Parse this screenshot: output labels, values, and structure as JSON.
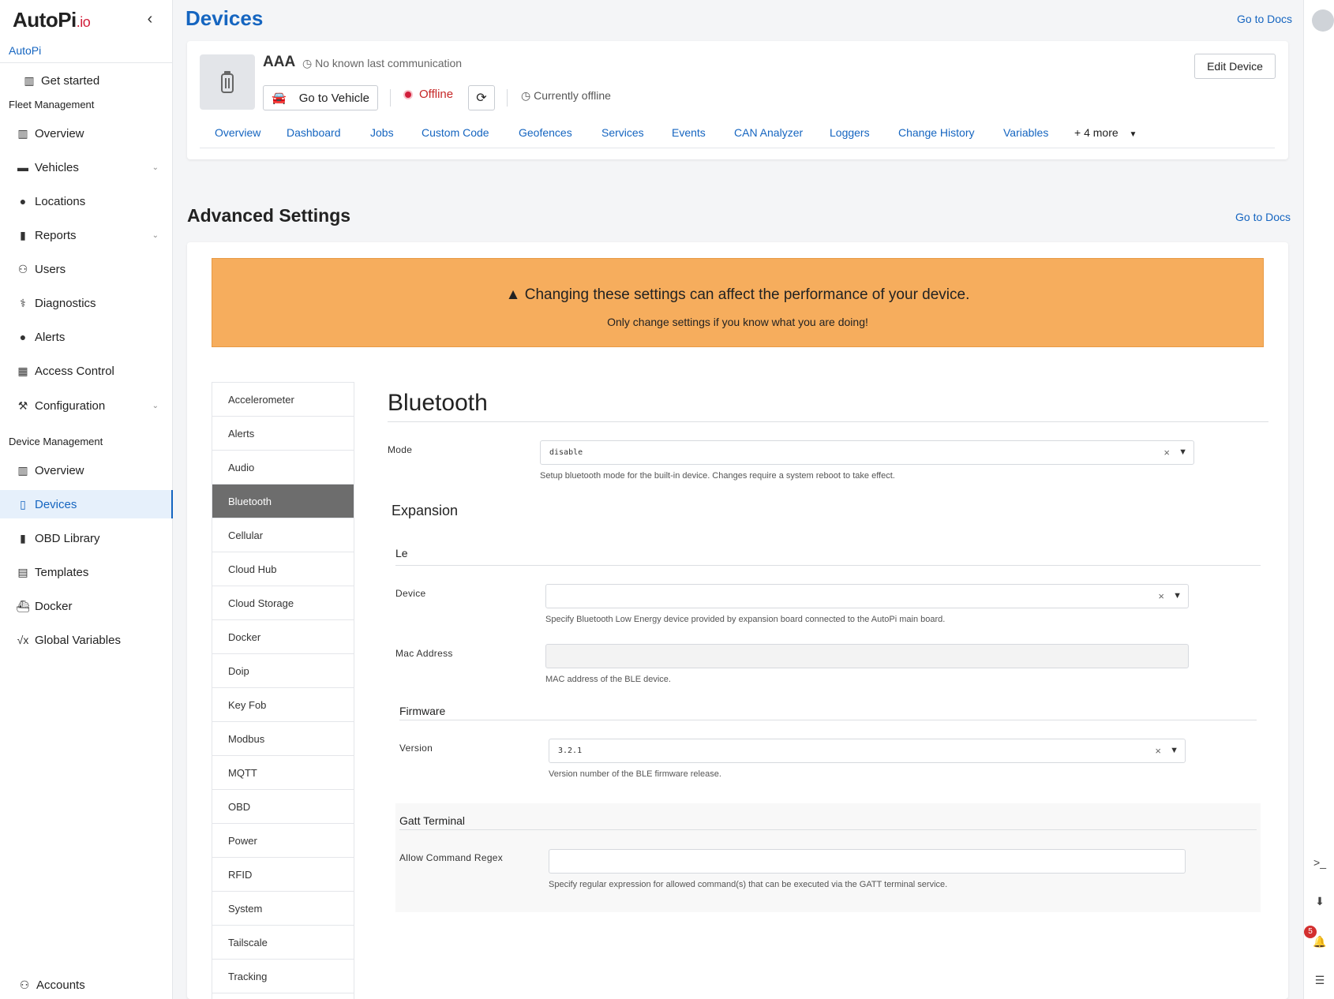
{
  "app": {
    "logo_main": "AutoPi",
    "logo_suffix": ".io",
    "org": "AutoPi"
  },
  "sidebar": {
    "get_started": "Get started",
    "fleet_label": "Fleet Management",
    "fleet_items": [
      {
        "label": "Overview",
        "icon": "chart-icon"
      },
      {
        "label": "Vehicles",
        "icon": "car-icon"
      },
      {
        "label": "Locations",
        "icon": "pin-icon"
      },
      {
        "label": "Reports",
        "icon": "file-icon"
      },
      {
        "label": "Users",
        "icon": "user-icon"
      },
      {
        "label": "Diagnostics",
        "icon": "stethoscope-icon"
      },
      {
        "label": "Alerts",
        "icon": "alert-icon"
      },
      {
        "label": "Access Control",
        "icon": "lock-icon"
      },
      {
        "label": "Configuration",
        "icon": "wrench-icon"
      }
    ],
    "device_label": "Device Management",
    "device_items": [
      {
        "label": "Overview",
        "icon": "chart-icon"
      },
      {
        "label": "Devices",
        "icon": "device-icon"
      },
      {
        "label": "OBD Library",
        "icon": "book-icon"
      },
      {
        "label": "Templates",
        "icon": "template-icon"
      },
      {
        "label": "Docker",
        "icon": "docker-icon"
      },
      {
        "label": "Global Variables",
        "icon": "variable-icon"
      }
    ],
    "accounts": "Accounts"
  },
  "header": {
    "title": "Devices",
    "docs": "Go to Docs"
  },
  "device": {
    "name": "AAA",
    "last_comm": "No known last communication",
    "go_to_vehicle": "Go to Vehicle",
    "status": "Offline",
    "current": "Currently offline",
    "edit": "Edit Device",
    "tabs": [
      "Overview",
      "Dashboard",
      "Jobs",
      "Custom Code",
      "Geofences",
      "Services",
      "Events",
      "CAN Analyzer",
      "Loggers",
      "Change History",
      "Variables",
      "+ 4 more"
    ]
  },
  "advanced": {
    "title": "Advanced Settings",
    "docs": "Go to Docs",
    "warning_title": "Changing these settings can affect the performance of your device.",
    "warning_sub": "Only change settings if you know what you are doing!",
    "menu": [
      "Accelerometer",
      "Alerts",
      "Audio",
      "Bluetooth",
      "Cellular",
      "Cloud Hub",
      "Cloud Storage",
      "Docker",
      "Doip",
      "Key Fob",
      "Modbus",
      "MQTT",
      "OBD",
      "Power",
      "RFID",
      "System",
      "Tailscale",
      "Tracking"
    ],
    "active_menu": "Bluetooth"
  },
  "bluetooth": {
    "title": "Bluetooth",
    "mode_label": "Mode",
    "mode_value": "disable",
    "mode_help": "Setup bluetooth mode for the built-in device. Changes require a system reboot to take effect.",
    "expansion": "Expansion",
    "le": "Le",
    "device_label": "Device",
    "device_value": "",
    "device_help": "Specify Bluetooth Low Energy device provided by expansion board connected to the AutoPi main board.",
    "mac_label": "Mac Address",
    "mac_value": "",
    "mac_help": "MAC address of the BLE device.",
    "firmware": "Firmware",
    "version_label": "Version",
    "version_value": "3.2.1",
    "version_help": "Version number of the BLE firmware release.",
    "gatt": "Gatt Terminal",
    "regex_label": "Allow Command Regex",
    "regex_value": "",
    "regex_help": "Specify regular expression for allowed command(s) that can be executed via the GATT terminal service."
  },
  "rail": {
    "notifications": "5"
  },
  "colors": {
    "accent": "#1565c0",
    "warning": "#f6ad5d",
    "offline": "#d11e3a"
  }
}
